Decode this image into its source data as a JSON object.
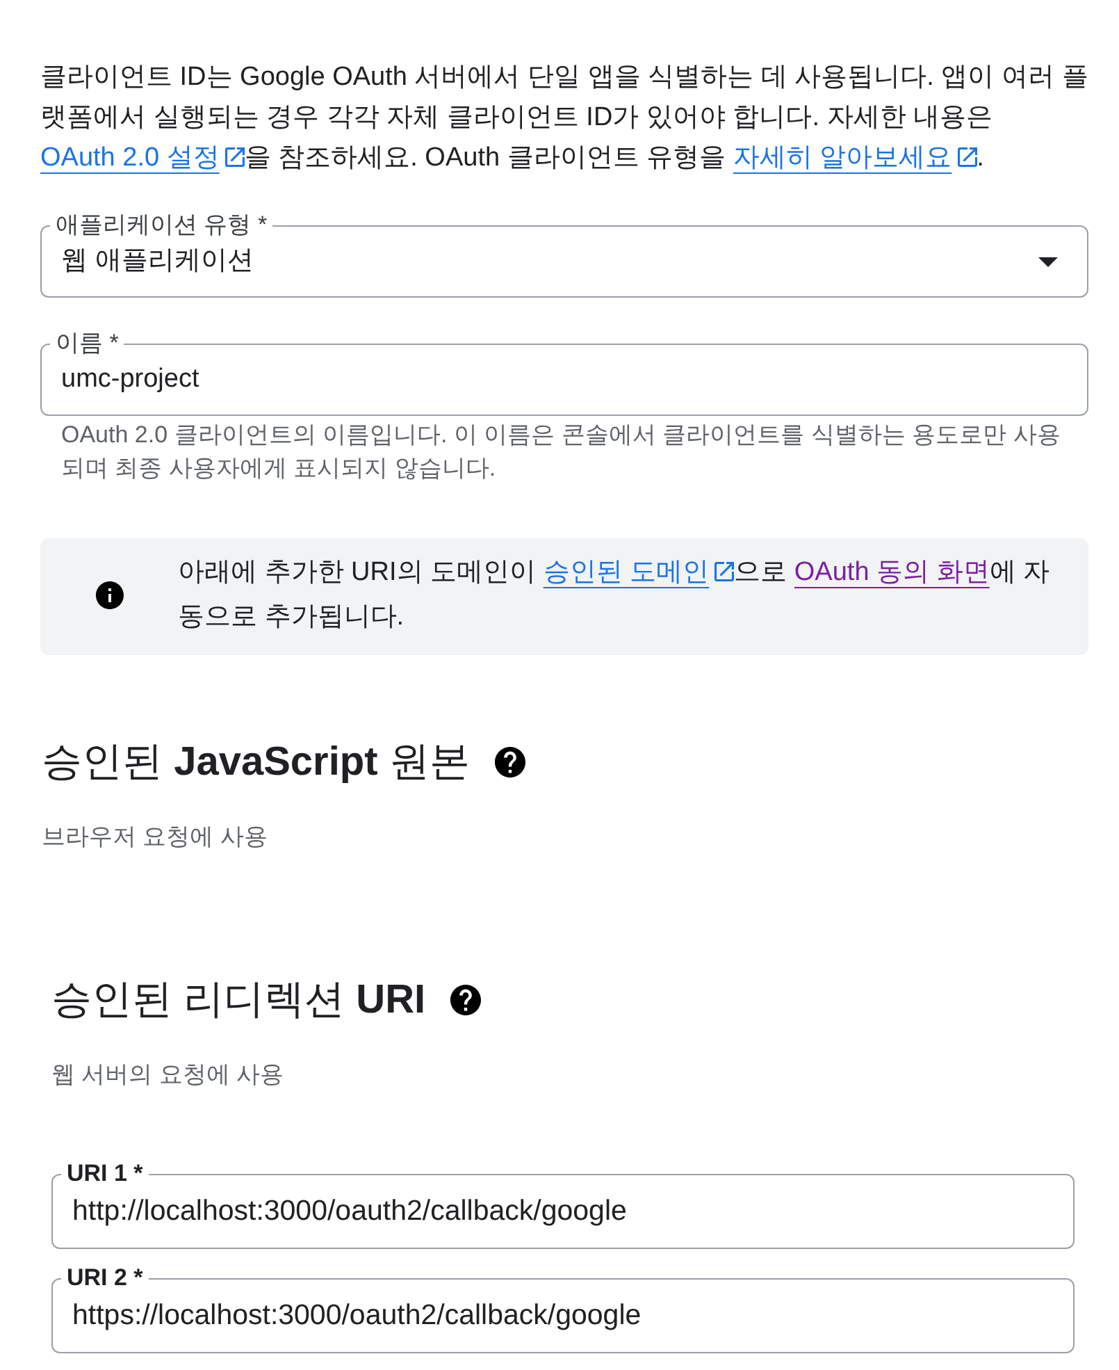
{
  "intro": [
    {
      "kind": "text",
      "text": "클라이언트 ID는 Google OAuth 서버에서 단일 앱을 식별하는 데 사용됩니다. 앱이 여러 플랫폼에서 실행되는 경우 각각 자체 클라이언트 ID가 있어야 합니다. 자세한 내용은 "
    },
    {
      "kind": "link",
      "text": "OAuth 2.0 설정",
      "external": true,
      "visited": false
    },
    {
      "kind": "text",
      "text": "을 참조하세요. OAuth 클라이언트 유형을 "
    },
    {
      "kind": "link",
      "text": "자세히 알아보세요",
      "external": true,
      "visited": false
    },
    {
      "kind": "text",
      "text": "."
    }
  ],
  "fields": [
    {
      "kind": "select",
      "label": "애플리케이션 유형 *",
      "value": "웹 애플리케이션"
    },
    {
      "kind": "text",
      "label": "이름 *",
      "value": "umc-project",
      "helper": "OAuth 2.0 클라이언트의 이름입니다. 이 이름은 콘솔에서 클라이언트를 식별하는 용도로만 사용되며 최종 사용자에게 표시되지 않습니다."
    }
  ],
  "banner": {
    "segments": [
      {
        "kind": "text",
        "text": "아래에 추가한 URI의 도메인이 "
      },
      {
        "kind": "link",
        "text": "승인된 도메인",
        "external": true,
        "visited": false
      },
      {
        "kind": "text",
        "text": "으로 "
      },
      {
        "kind": "link",
        "text": "OAuth 동의 화면",
        "external": false,
        "visited": true
      },
      {
        "kind": "text",
        "text": "에 자동으로 추가됩니다."
      }
    ]
  },
  "sections": [
    {
      "title": "승인된 **JavaScript** 원본",
      "subtitle": "브라우저 요청에 사용"
    },
    {
      "title": "승인된 리디렉션 **URI**",
      "subtitle": "웹 서버의 요청에 사용",
      "uris": [
        {
          "label": "URI 1 *",
          "value": "http://localhost:3000/oauth2/callback/google"
        },
        {
          "label": "URI 2 *",
          "value": "https://localhost:3000/oauth2/callback/google"
        }
      ]
    }
  ]
}
